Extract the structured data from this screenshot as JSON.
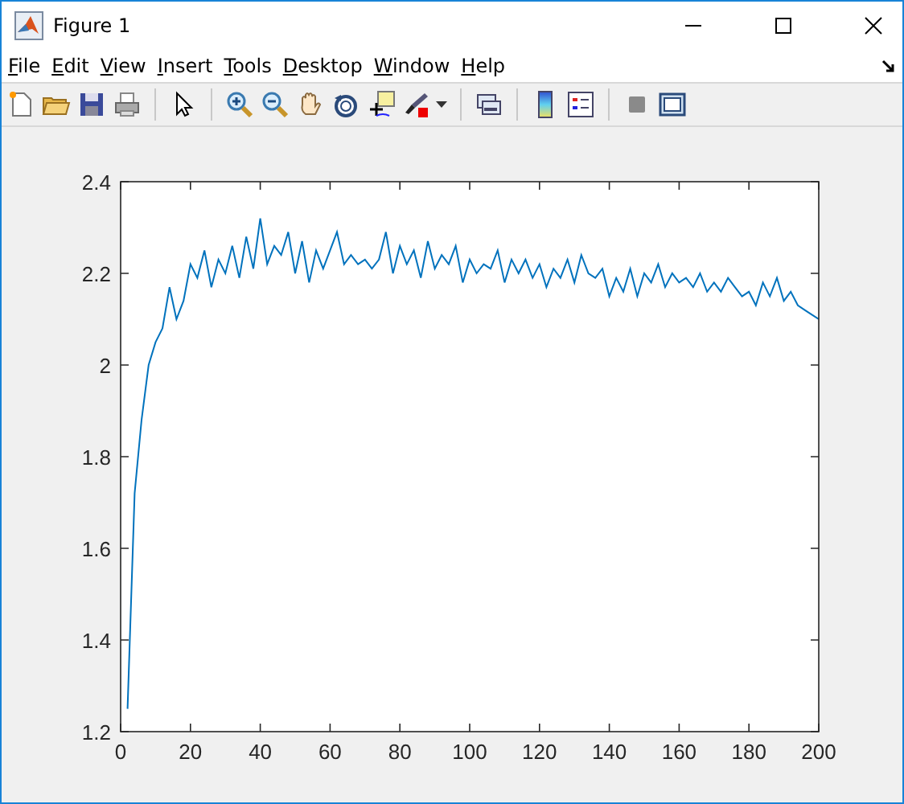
{
  "window": {
    "title": "Figure 1"
  },
  "menu": [
    "File",
    "Edit",
    "View",
    "Insert",
    "Tools",
    "Desktop",
    "Window",
    "Help"
  ],
  "plot": {
    "chart_data": {
      "type": "line",
      "xlim": [
        0,
        200
      ],
      "ylim": [
        1.2,
        2.4
      ],
      "xticks": [
        0,
        20,
        40,
        60,
        80,
        100,
        120,
        140,
        160,
        180,
        200
      ],
      "yticks": [
        1.2,
        1.4,
        1.6,
        1.8,
        2,
        2.2,
        2.4
      ],
      "x": [
        2,
        4,
        6,
        8,
        10,
        12,
        14,
        16,
        18,
        20,
        22,
        24,
        26,
        28,
        30,
        32,
        34,
        36,
        38,
        40,
        42,
        44,
        46,
        48,
        50,
        52,
        54,
        56,
        58,
        60,
        62,
        64,
        66,
        68,
        70,
        72,
        74,
        76,
        78,
        80,
        82,
        84,
        86,
        88,
        90,
        92,
        94,
        96,
        98,
        100,
        102,
        104,
        106,
        108,
        110,
        112,
        114,
        116,
        118,
        120,
        122,
        124,
        126,
        128,
        130,
        132,
        134,
        136,
        138,
        140,
        142,
        144,
        146,
        148,
        150,
        152,
        154,
        156,
        158,
        160,
        162,
        164,
        166,
        168,
        170,
        172,
        174,
        176,
        178,
        180,
        182,
        184,
        186,
        188,
        190,
        192,
        194,
        196,
        198,
        200
      ],
      "series": [
        {
          "color": "#0072bd",
          "values": [
            1.25,
            1.72,
            1.88,
            2.0,
            2.05,
            2.08,
            2.17,
            2.1,
            2.14,
            2.22,
            2.19,
            2.25,
            2.17,
            2.23,
            2.2,
            2.26,
            2.19,
            2.28,
            2.21,
            2.32,
            2.22,
            2.26,
            2.24,
            2.29,
            2.2,
            2.27,
            2.18,
            2.25,
            2.21,
            2.25,
            2.29,
            2.22,
            2.24,
            2.22,
            2.23,
            2.21,
            2.23,
            2.29,
            2.2,
            2.26,
            2.22,
            2.25,
            2.19,
            2.27,
            2.21,
            2.24,
            2.22,
            2.26,
            2.18,
            2.23,
            2.2,
            2.22,
            2.21,
            2.25,
            2.18,
            2.23,
            2.2,
            2.23,
            2.19,
            2.22,
            2.17,
            2.21,
            2.19,
            2.23,
            2.18,
            2.24,
            2.2,
            2.19,
            2.21,
            2.15,
            2.19,
            2.16,
            2.21,
            2.15,
            2.2,
            2.18,
            2.22,
            2.17,
            2.2,
            2.18,
            2.19,
            2.17,
            2.2,
            2.16,
            2.18,
            2.16,
            2.19,
            2.17,
            2.15,
            2.16,
            2.13,
            2.18,
            2.15,
            2.19,
            2.14,
            2.16,
            2.13,
            2.12,
            2.11,
            2.1
          ]
        }
      ]
    }
  }
}
